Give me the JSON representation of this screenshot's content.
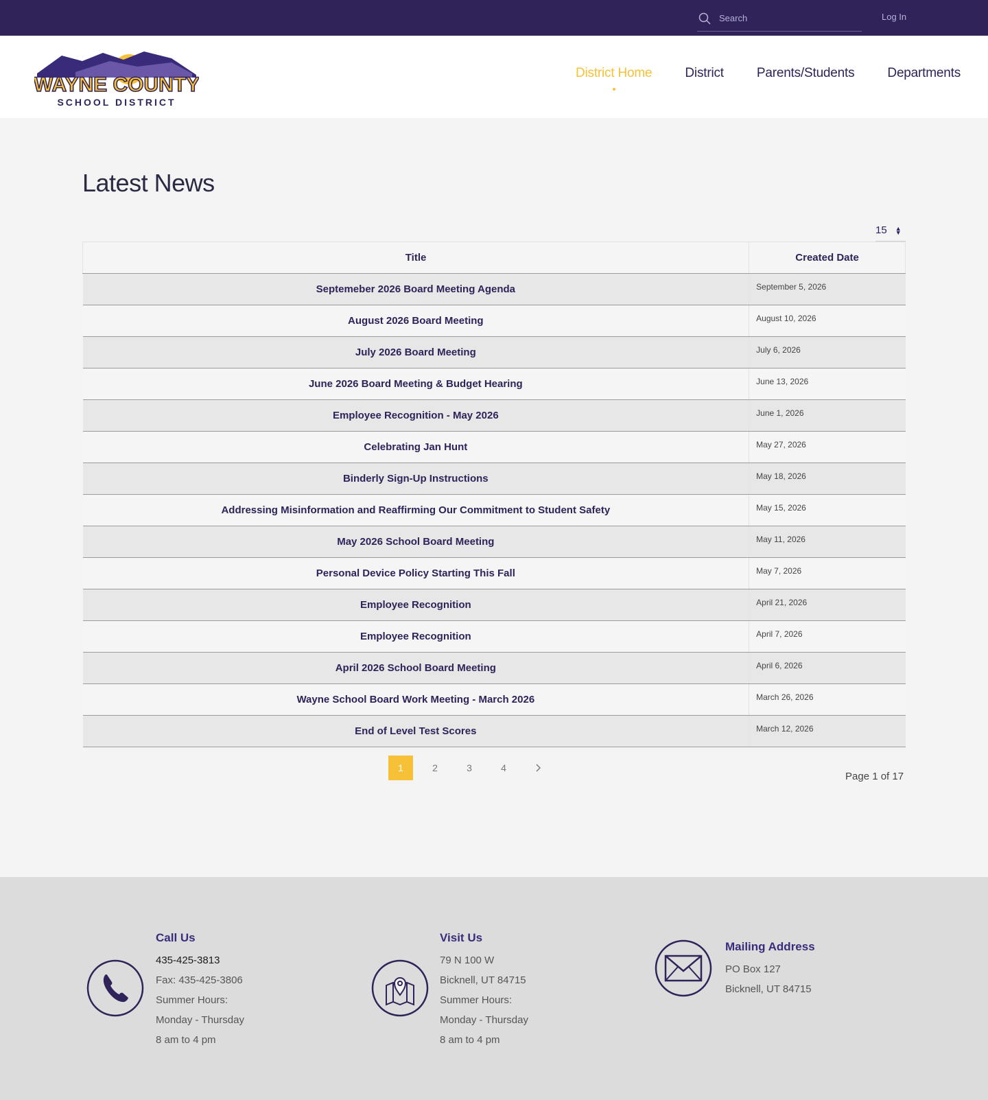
{
  "topbar": {
    "search_placeholder": "Search",
    "login_label": "Log In"
  },
  "logo": {
    "line1": "WAYNE COUNTY",
    "line2": "SCHOOL DISTRICT"
  },
  "nav": {
    "items": [
      {
        "label": "District Home",
        "active": true
      },
      {
        "label": "District",
        "active": false
      },
      {
        "label": "Parents/Students",
        "active": false
      },
      {
        "label": "Departments",
        "active": false
      }
    ]
  },
  "main": {
    "title": "Latest News",
    "page_size": "15",
    "table": {
      "headers": [
        "Title",
        "Created Date"
      ],
      "rows": [
        {
          "title": "Septemeber 2026 Board Meeting Agenda",
          "date": "September 5, 2026"
        },
        {
          "title": "August 2026 Board Meeting",
          "date": "August 10, 2026"
        },
        {
          "title": "July 2026 Board Meeting",
          "date": "July 6, 2026"
        },
        {
          "title": "June 2026 Board Meeting & Budget Hearing",
          "date": "June 13, 2026"
        },
        {
          "title": "Employee Recognition - May 2026",
          "date": "June 1, 2026"
        },
        {
          "title": "Celebrating Jan Hunt",
          "date": "May 27, 2026"
        },
        {
          "title": "Binderly Sign-Up Instructions",
          "date": "May 18, 2026"
        },
        {
          "title": "Addressing Misinformation and Reaffirming Our Commitment to Student Safety",
          "date": "May 15, 2026"
        },
        {
          "title": "May 2026 School Board Meeting",
          "date": "May 11, 2026"
        },
        {
          "title": "Personal Device Policy Starting This Fall",
          "date": "May 7, 2026"
        },
        {
          "title": "Employee Recognition",
          "date": "April 21, 2026"
        },
        {
          "title": "Employee Recognition",
          "date": "April 7, 2026"
        },
        {
          "title": "April 2026 School Board Meeting",
          "date": "April 6, 2026"
        },
        {
          "title": "Wayne School Board Work Meeting - March 2026",
          "date": "March 26, 2026"
        },
        {
          "title": "End of Level Test Scores",
          "date": "March 12, 2026"
        }
      ]
    },
    "pagination": {
      "pages": [
        "1",
        "2",
        "3",
        "4"
      ],
      "current": "1",
      "next_icon": "chevron-right-icon",
      "summary": "Page 1 of 17"
    }
  },
  "footer": {
    "call": {
      "heading": "Call Us",
      "phone": "435-425-3813",
      "fax": "Fax: 435-425-3806",
      "hours_label": "Summer Hours:",
      "days": "Monday - Thursday",
      "time": "8 am to 4 pm",
      "icon": "phone-icon"
    },
    "visit": {
      "heading": "Visit Us",
      "street": "79 N 100 W",
      "city": "Bicknell, UT 84715",
      "hours_label": "Summer Hours:",
      "days": "Monday - Thursday",
      "time": "8 am to 4 pm",
      "icon": "map-pin-icon"
    },
    "mail": {
      "heading": "Mailing Address",
      "box": "PO Box 127",
      "city": "Bicknell, UT 84715",
      "icon": "envelope-icon"
    }
  },
  "colors": {
    "brand_purple": "#2f2359",
    "accent_yellow": "#f6c136"
  }
}
